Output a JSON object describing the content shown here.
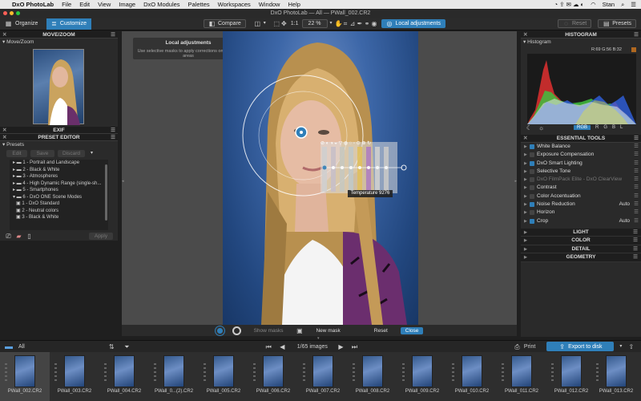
{
  "menubar": {
    "apple": "",
    "app": "DxO PhotoLab",
    "items": [
      "File",
      "Edit",
      "View",
      "Image",
      "DxO Modules",
      "Palettes",
      "Workspaces",
      "Window",
      "Help"
    ],
    "user": "Stan"
  },
  "window": {
    "title": "DxO PhotoLab — All — PWall_002.CR2"
  },
  "toolbar": {
    "organize": "Organize",
    "customize": "Customize",
    "compare": "Compare",
    "ratio": "1:1",
    "zoom": "22 %",
    "local_adjustments": "Local adjustments",
    "reset": "Reset",
    "presets": "Presets"
  },
  "left": {
    "move_zoom": "MOVE/ZOOM",
    "move_zoom_sub": "Move/Zoom",
    "exif": "EXIF",
    "preset_editor": "PRESET EDITOR",
    "presets_sub": "Presets",
    "edit": "Edit",
    "save": "Save",
    "discard": "Discard",
    "apply": "Apply",
    "preset_items": [
      "1 - Portrait and Landscape",
      "2 - Black & White",
      "3 - Atmospheres",
      "4 - High Dynamic Range (single-sh...",
      "5 - Smartphones",
      "6 - DxO ONE Scene Modes",
      "1 - DxO Standard",
      "2 - Neutral colors",
      "3 - Black & White"
    ]
  },
  "canvas": {
    "tooltip_title": "Local adjustments",
    "tooltip_text": "Use selective masks to apply corrections on specific areas",
    "temperature": "Temperature 9276",
    "show_masks": "Show masks",
    "new_mask": "New mask",
    "reset": "Reset",
    "close": "Close"
  },
  "right": {
    "histogram": "HISTOGRAM",
    "histogram_sub": "Histogram",
    "rgb_readout": "R:69 G:56 B:32",
    "channels": [
      "RGB",
      "R",
      "G",
      "B",
      "L"
    ],
    "essential_tools": "ESSENTIAL TOOLS",
    "tools": [
      {
        "label": "White Balance",
        "value": "",
        "on": true
      },
      {
        "label": "Exposure Compensation",
        "value": "",
        "on": false
      },
      {
        "label": "DxO Smart Lighting",
        "value": "",
        "on": true
      },
      {
        "label": "Selective Tone",
        "value": "",
        "on": false
      },
      {
        "label": "DxO FilmPack Elite - DxO ClearView",
        "value": "",
        "on": false,
        "dim": true
      },
      {
        "label": "Contrast",
        "value": "",
        "on": false
      },
      {
        "label": "Color Accentuation",
        "value": "",
        "on": false
      },
      {
        "label": "Noise Reduction",
        "value": "Auto",
        "on": true
      },
      {
        "label": "Horizon",
        "value": "",
        "on": false
      },
      {
        "label": "Crop",
        "value": "Auto",
        "on": true
      }
    ],
    "sections": [
      "LIGHT",
      "COLOR",
      "DETAIL",
      "GEOMETRY"
    ]
  },
  "filmbar": {
    "all": "All",
    "count": "1/65 images",
    "print": "Print",
    "export": "Export to disk"
  },
  "filmstrip": [
    "PWall_002.CR2",
    "PWall_003.CR2",
    "PWall_004.CR2",
    "PWall_0...(2).CR2",
    "PWall_005.CR2",
    "PWall_006.CR2",
    "PWall_007.CR2",
    "PWall_008.CR2",
    "PWall_009.CR2",
    "PWall_010.CR2",
    "PWall_011.CR2",
    "PWall_012.CR2",
    "PWall_013.CR2"
  ],
  "colors": {
    "accent": "#2f7fb9",
    "panel": "#2a2a2a",
    "canvas": "#4b4b4b"
  }
}
